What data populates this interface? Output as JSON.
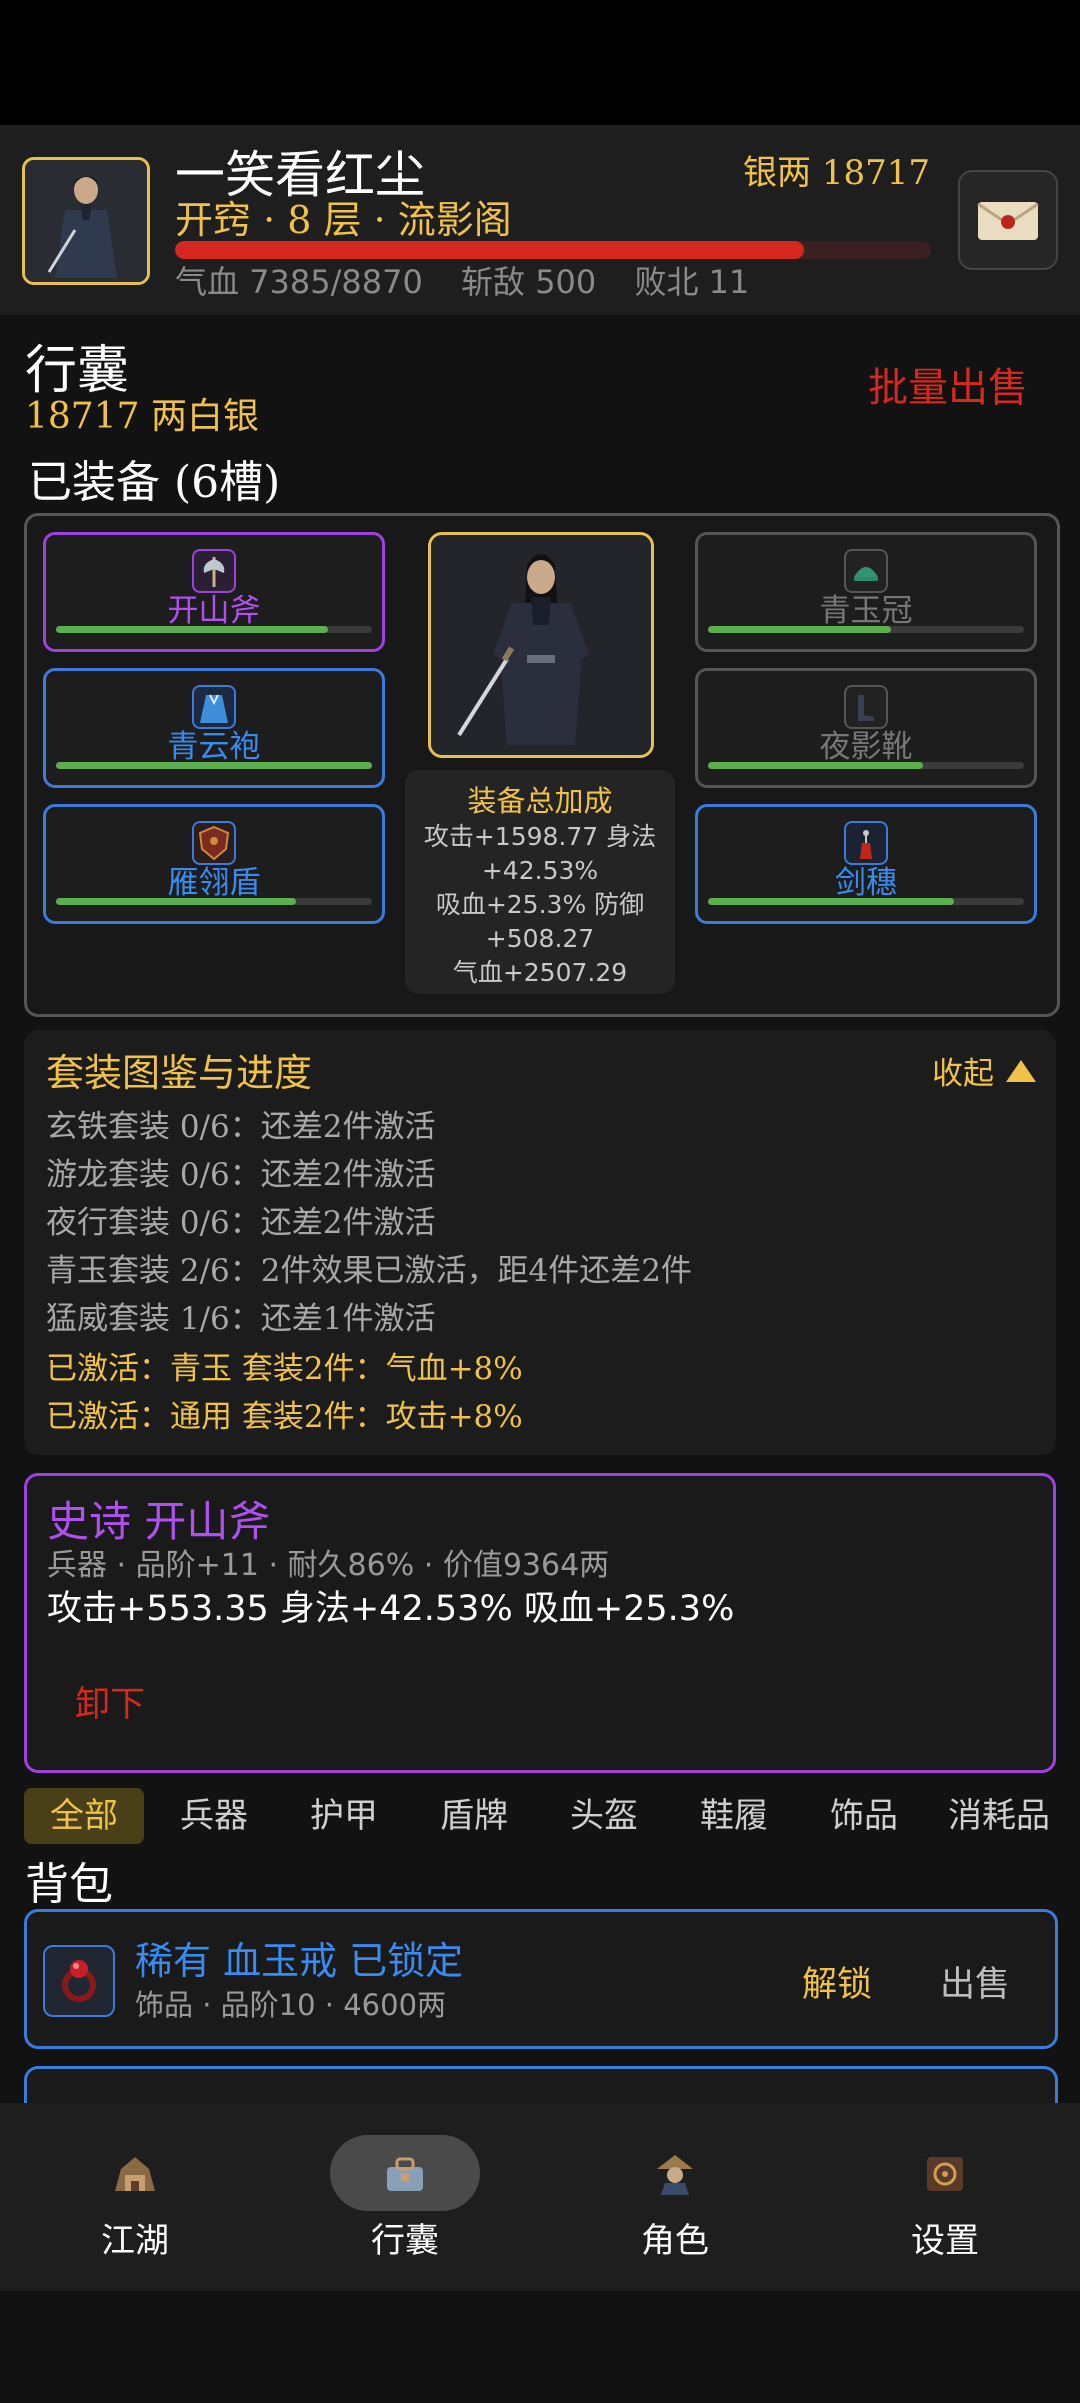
{
  "header": {
    "player_name": "一笑看红尘",
    "silver_label": "银两 18717",
    "rank": "开窍 · 8 层 · 流影阁",
    "hp_fraction": 0.832,
    "stats": [
      "气血 7385/8870",
      "斩敌 500",
      "败北 11"
    ]
  },
  "bag_section": {
    "title": "行囊",
    "silver_text": "18717 两白银",
    "batch_sell": "批量出售"
  },
  "equipped": {
    "title": "已装备 (6槽)",
    "left_slots": [
      {
        "label": "开山斧",
        "durability": 0.86,
        "rarity": "purple"
      },
      {
        "label": "青云袍",
        "durability": 1.0,
        "rarity": "blue"
      },
      {
        "label": "雁翎盾",
        "durability": 0.76,
        "rarity": "blue"
      }
    ],
    "right_slots": [
      {
        "label": "青玉冠",
        "durability": 0.58,
        "rarity": "gray"
      },
      {
        "label": "夜影靴",
        "durability": 0.68,
        "rarity": "gray"
      },
      {
        "label": "剑穗",
        "durability": 0.78,
        "rarity": "blue"
      }
    ],
    "bonus": {
      "title": "装备总加成",
      "lines": [
        "攻击+1598.77 身法",
        "+42.53%",
        "吸血+25.3% 防御",
        "+508.27",
        "气血+2507.29"
      ]
    }
  },
  "suits": {
    "title": "套装图鉴与进度",
    "collapse": "收起",
    "lines": [
      "玄铁套装 0/6：还差2件激活",
      "游龙套装 0/6：还差2件激活",
      "夜行套装 0/6：还差2件激活",
      "青玉套装 2/6：2件效果已激活，距4件还差2件",
      "猛威套装 1/6：还差1件激活"
    ],
    "active": [
      "已激活：青玉 套装2件：气血+8%",
      "已激活：通用 套装2件：攻击+8%"
    ]
  },
  "item_detail": {
    "title": "史诗 开山斧",
    "meta": "兵器 · 品阶+11 · 耐久86% · 价值9364两",
    "stats": "攻击+553.35  身法+42.53%  吸血+25.3%",
    "unequip": "卸下"
  },
  "tabs": [
    "全部",
    "兵器",
    "护甲",
    "盾牌",
    "头盔",
    "鞋履",
    "饰品",
    "消耗品"
  ],
  "backpack": {
    "title": "背包",
    "items": [
      {
        "title": "稀有 血玉戒  已锁定",
        "meta": "饰品 · 品阶10 · 4600两",
        "unlock": "解锁",
        "sell": "出售"
      }
    ]
  },
  "nav": [
    {
      "label": "江湖",
      "icon": "jianghu-icon"
    },
    {
      "label": "行囊",
      "icon": "bag-icon"
    },
    {
      "label": "角色",
      "icon": "character-icon"
    },
    {
      "label": "设置",
      "icon": "settings-icon"
    }
  ],
  "colors": {
    "gold": "#f0c24a",
    "red": "#d6281e",
    "epic": "#a040e0",
    "rare": "#3a7bdc"
  }
}
